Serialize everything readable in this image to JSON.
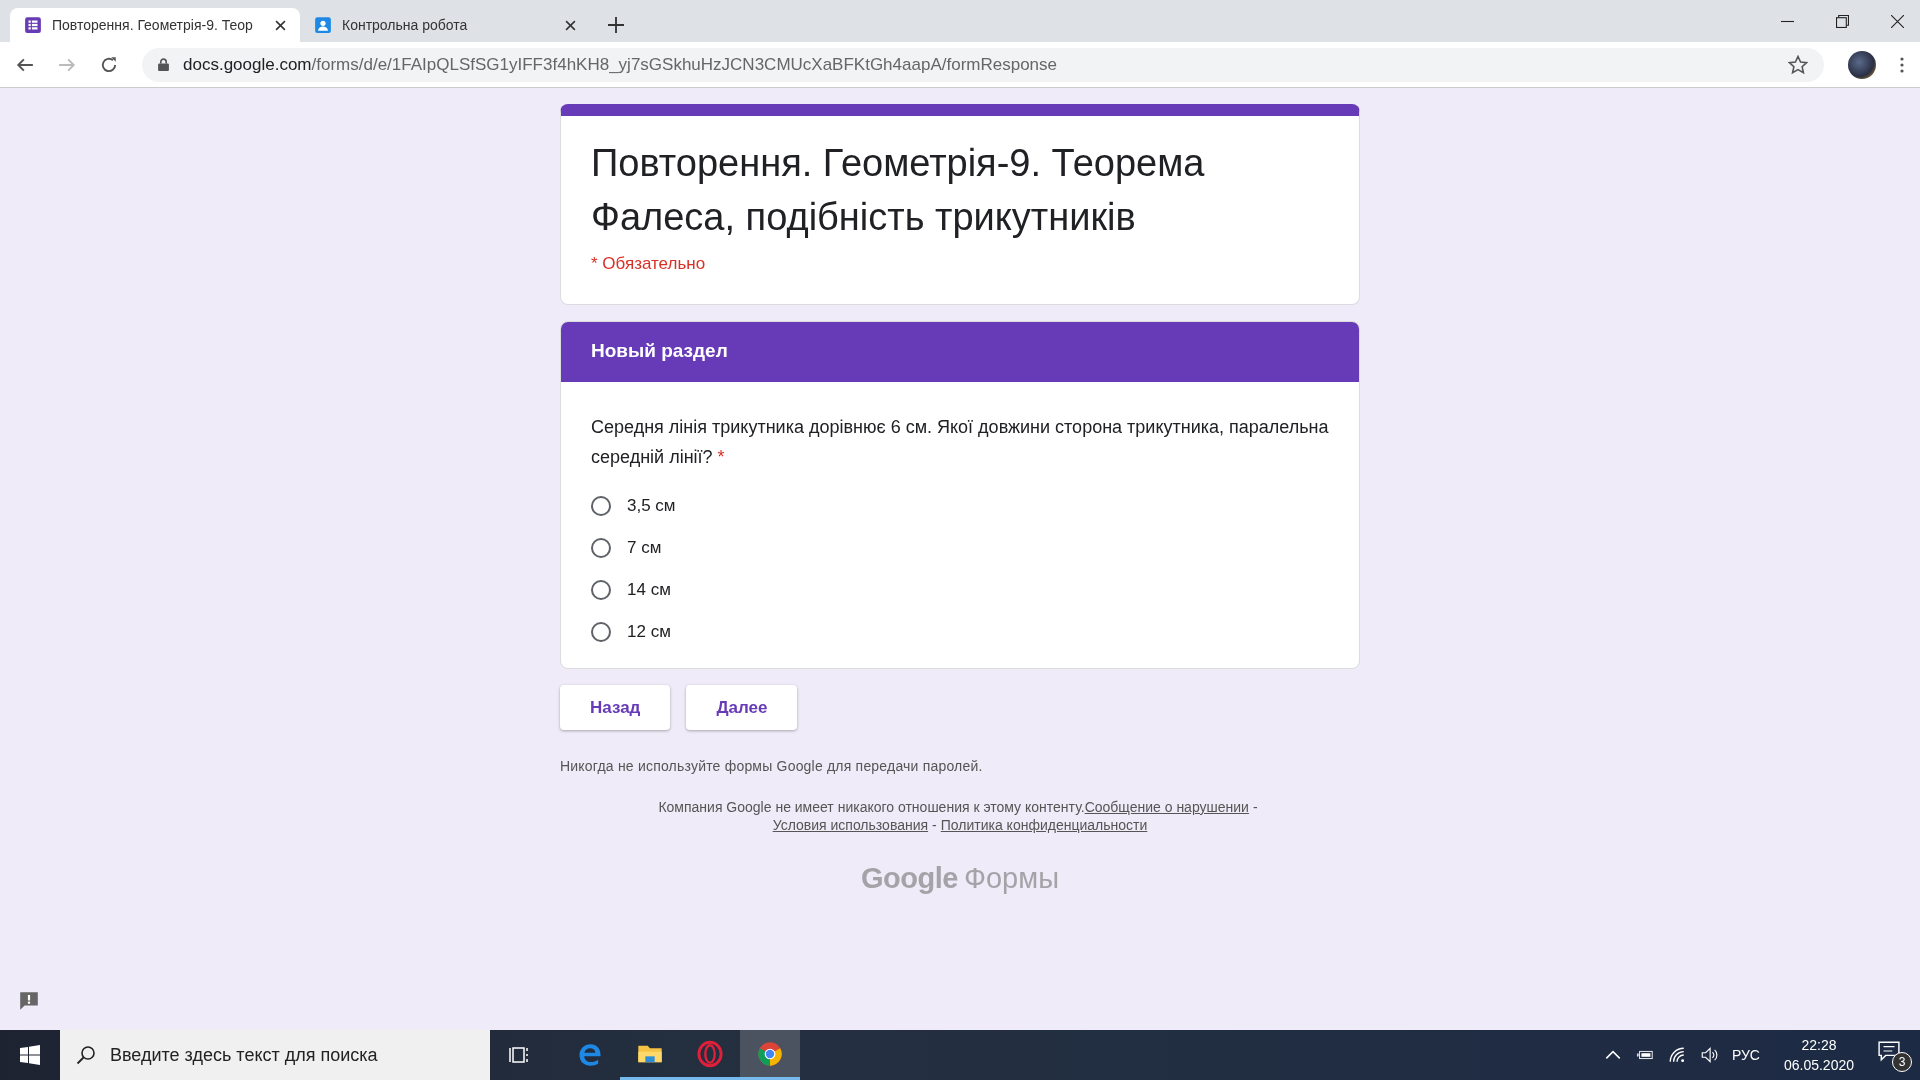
{
  "browser": {
    "tabs": [
      {
        "title": "Повторення. Геометрія-9. Теор",
        "kind": "forms",
        "selected": true
      },
      {
        "title": "Контрольна робота",
        "kind": "classroom",
        "selected": false
      }
    ],
    "url_host": "docs.google.com",
    "url_path": "/forms/d/e/1FAIpQLSfSG1yIFF3f4hKH8_yj7sGSkhuHzJCN3CMUcXaBFKtGh4aapA/formResponse"
  },
  "form": {
    "title": "Повторення. Геометрія-9. Теорема Фалеса, подібність трикутників",
    "required_note": "* Обязательно",
    "section_title": "Новый раздел",
    "question": {
      "text": "Середня лінія трикутника дорівнює 6 см. Якої довжини сторона трикутника, паралельна середній лінії?",
      "required_mark": "*",
      "options": [
        {
          "label": "3,5 см",
          "selected": false
        },
        {
          "label": "7 см",
          "selected": false
        },
        {
          "label": "14 см",
          "selected": false
        },
        {
          "label": "12 см",
          "selected": false
        }
      ]
    },
    "buttons": [
      "Назад",
      "Далее"
    ],
    "password_warning": "Никогда не используйте формы Google для передачи паролей.",
    "disclaimer": "Компания Google не имеет никакого отношения к этому контенту.",
    "links": [
      "Сообщение о нарушении",
      "Условия использования",
      "Политика конфиденциальности"
    ],
    "link_separator": "-",
    "logo": {
      "brand": "Google",
      "product": "Формы"
    }
  },
  "taskbar": {
    "search_placeholder": "Введите здесь текст для поиска",
    "language": "РУС",
    "time": "22:28",
    "date": "06.05.2020",
    "notifications": "3"
  }
}
